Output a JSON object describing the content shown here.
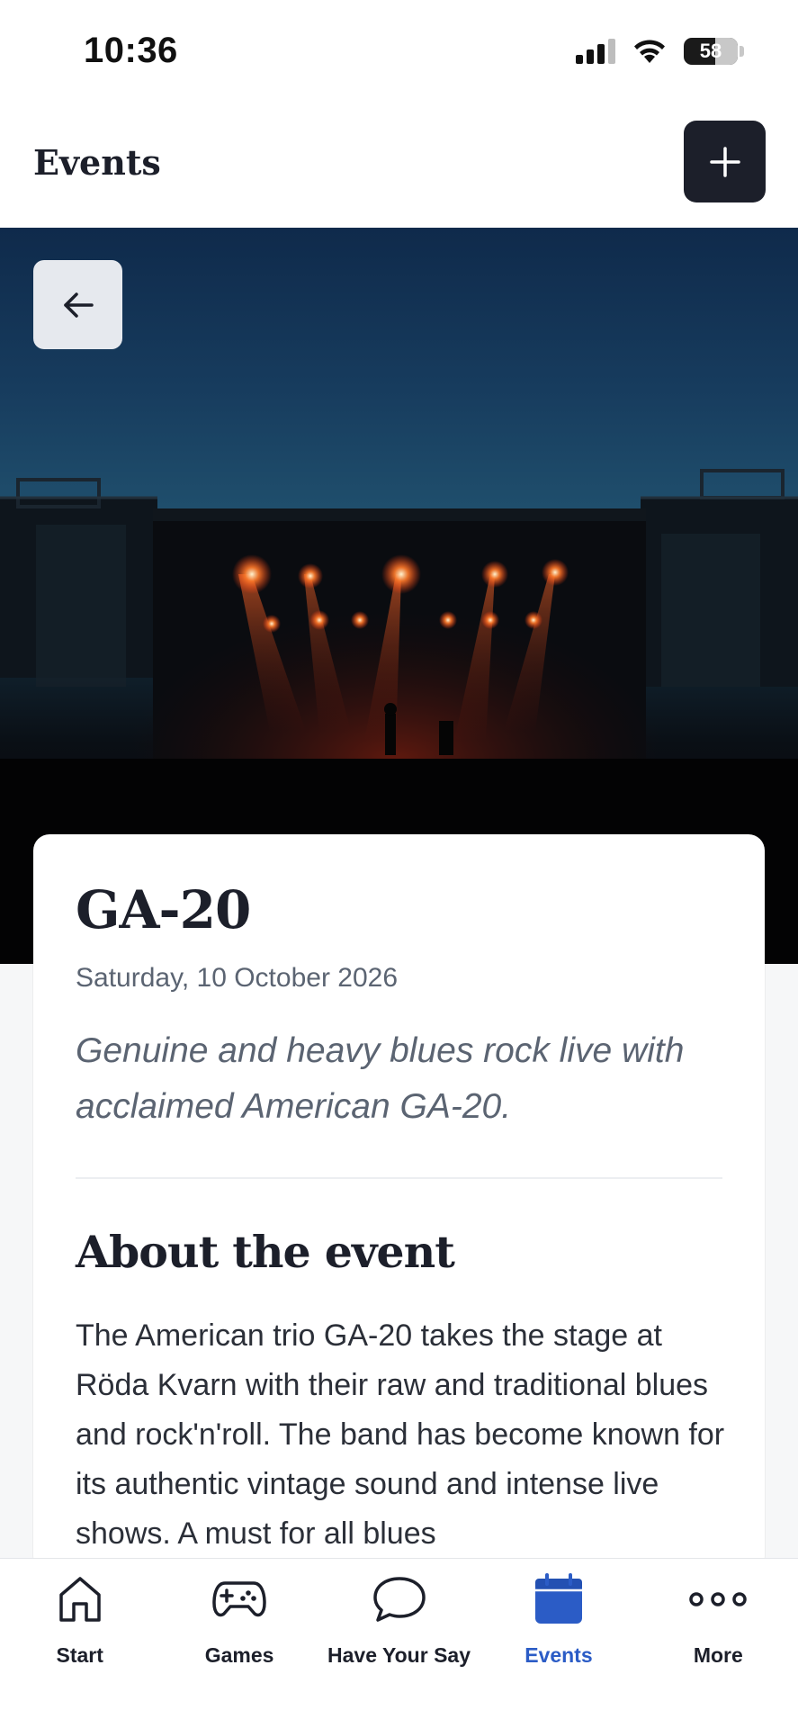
{
  "status_bar": {
    "time": "10:36",
    "battery": "58"
  },
  "header": {
    "title": "Events",
    "add_icon": "plus-icon"
  },
  "hero": {
    "back_icon": "arrow-left-icon",
    "image": "concert-stage-red-lights"
  },
  "event": {
    "title": "GA-20",
    "date": "Saturday, 10 October 2026",
    "subtitle": "Genuine and heavy blues rock live with acclaimed American GA-20.",
    "section_heading": "About the event",
    "description": "The American trio GA-20 takes the stage at Röda Kvarn with their raw and traditional blues and rock'n'roll. The band has become known for its authentic vintage sound and intense live shows. A must for all blues"
  },
  "tabs": [
    {
      "label": "Start",
      "icon": "home-icon"
    },
    {
      "label": "Games",
      "icon": "gamepad-icon"
    },
    {
      "label": "Have Your Say",
      "icon": "speech-bubble-icon"
    },
    {
      "label": "Events",
      "icon": "calendar-icon",
      "active": true
    },
    {
      "label": "More",
      "icon": "more-dots-icon"
    }
  ],
  "colors": {
    "accent": "#2b5cc6",
    "dark": "#1c1f2a",
    "muted": "#5b6472"
  }
}
